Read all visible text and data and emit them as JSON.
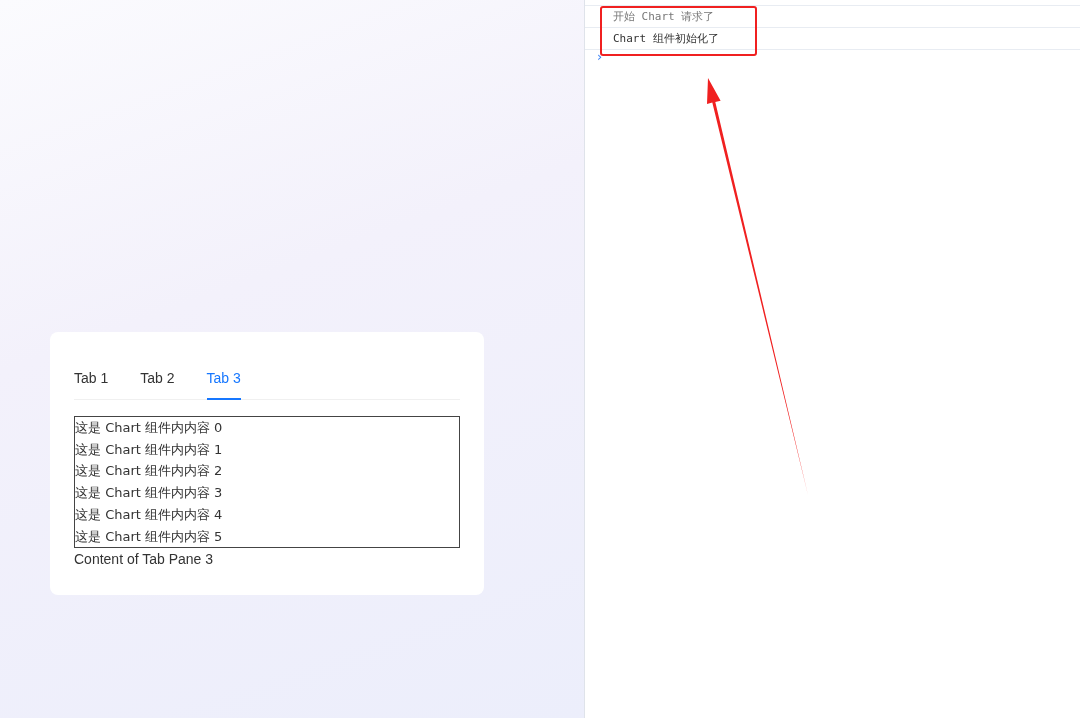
{
  "tabs": [
    {
      "label": "Tab 1",
      "selected": false
    },
    {
      "label": "Tab 2",
      "selected": false
    },
    {
      "label": "Tab 3",
      "selected": true
    }
  ],
  "chart_lines": [
    "这是 Chart 组件内内容 0",
    "这是 Chart 组件内内容 1",
    "这是 Chart 组件内内容 2",
    "这是 Chart 组件内内容 3",
    "这是 Chart 组件内内容 4",
    "这是 Chart 组件内内容 5"
  ],
  "pane_text": "Content of Tab Pane 3",
  "console": {
    "messages": [
      {
        "text": "开始 Chart 请求了",
        "kind": "dim"
      },
      {
        "text": "Chart 组件初始化了",
        "kind": "normal"
      }
    ],
    "prompt": "›"
  }
}
